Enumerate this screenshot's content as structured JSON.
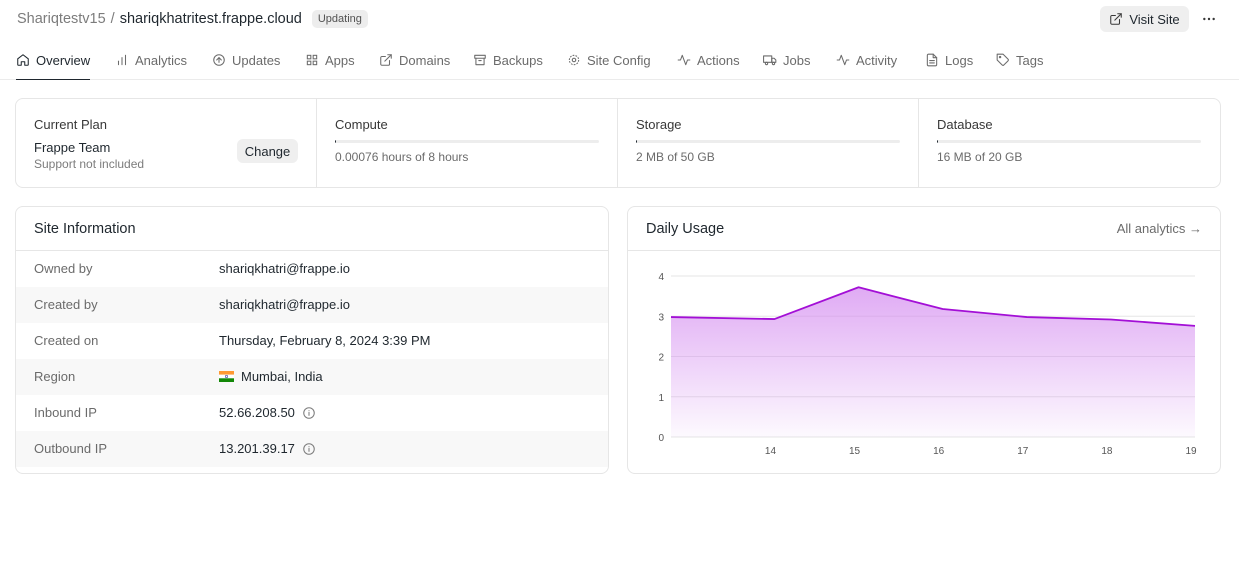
{
  "header": {
    "breadcrumb_parent": "Shariqtestv15",
    "breadcrumb_sep": "/",
    "site_name": "shariqkhatritest.frappe.cloud",
    "status_badge": "Updating",
    "visit_site_label": "Visit Site"
  },
  "tabs": [
    {
      "label": "Overview",
      "icon": "home-icon"
    },
    {
      "label": "Analytics",
      "icon": "bar-chart-icon"
    },
    {
      "label": "Updates",
      "icon": "arrow-up-circle-icon"
    },
    {
      "label": "Apps",
      "icon": "grid-icon"
    },
    {
      "label": "Domains",
      "icon": "external-link-icon"
    },
    {
      "label": "Backups",
      "icon": "archive-icon"
    },
    {
      "label": "Site Config",
      "icon": "gear-icon"
    },
    {
      "label": "Actions",
      "icon": "activity-icon"
    },
    {
      "label": "Jobs",
      "icon": "truck-icon"
    },
    {
      "label": "Activity",
      "icon": "activity-icon"
    },
    {
      "label": "Logs",
      "icon": "file-text-icon"
    },
    {
      "label": "Tags",
      "icon": "tag-icon"
    }
  ],
  "plan": {
    "title": "Current Plan",
    "name": "Frappe Team",
    "support": "Support not included",
    "change_label": "Change"
  },
  "usage": {
    "compute": {
      "title": "Compute",
      "text": "0.00076 hours of 8 hours",
      "fraction": 0.0001
    },
    "storage": {
      "title": "Storage",
      "text": "2 MB of 50 GB",
      "fraction": 4e-05
    },
    "database": {
      "title": "Database",
      "text": "16 MB of 20 GB",
      "fraction": 0.0008
    }
  },
  "site_info": {
    "title": "Site Information",
    "rows": [
      {
        "label": "Owned by",
        "value": "shariqkhatri@frappe.io"
      },
      {
        "label": "Created by",
        "value": "shariqkhatri@frappe.io"
      },
      {
        "label": "Created on",
        "value": "Thursday, February 8, 2024 3:39 PM"
      },
      {
        "label": "Region",
        "value": "Mumbai, India"
      },
      {
        "label": "Inbound IP",
        "value": "52.66.208.50"
      },
      {
        "label": "Outbound IP",
        "value": "13.201.39.17"
      }
    ]
  },
  "daily_usage": {
    "title": "Daily Usage",
    "link_label": "All analytics →"
  },
  "colors": {
    "line": "#a30fd6",
    "area": "#d58ef0"
  },
  "chart_data": {
    "type": "area",
    "title": "Daily Usage",
    "x": [
      13,
      14,
      15,
      16,
      17,
      18,
      19
    ],
    "x_start": 13,
    "x_end": 19.23,
    "points": [
      {
        "x": 13.0,
        "y": 2.98
      },
      {
        "x": 14.23,
        "y": 2.93
      },
      {
        "x": 15.23,
        "y": 3.72
      },
      {
        "x": 16.23,
        "y": 3.18
      },
      {
        "x": 17.23,
        "y": 2.98
      },
      {
        "x": 18.23,
        "y": 2.92
      },
      {
        "x": 19.23,
        "y": 2.76
      }
    ],
    "xticks": [
      "14",
      "15",
      "16",
      "17",
      "18",
      "19"
    ],
    "xtick_values": [
      14.23,
      15.23,
      16.23,
      17.23,
      18.23,
      19.23
    ],
    "yticks": [
      0,
      1,
      2,
      3,
      4
    ],
    "ylim": [
      0,
      4
    ],
    "grid": true,
    "legend": "none"
  }
}
